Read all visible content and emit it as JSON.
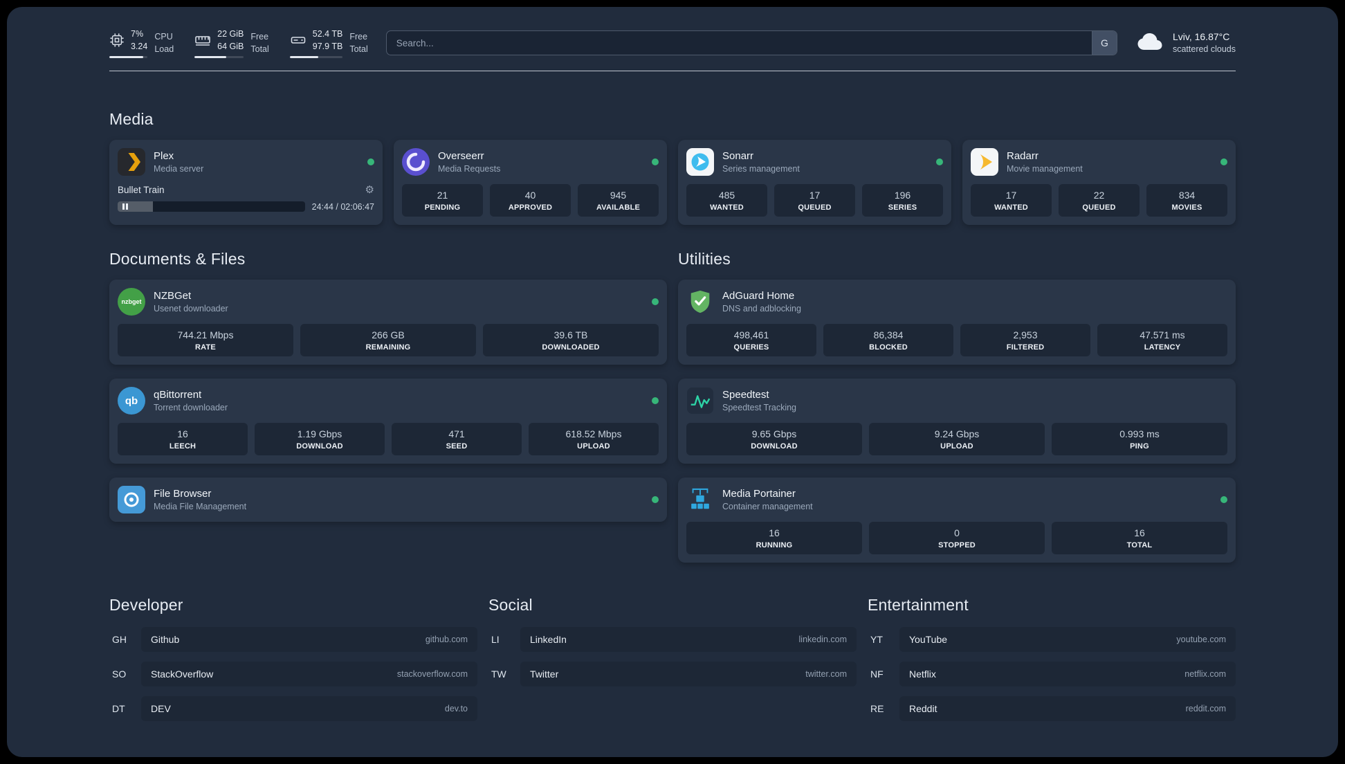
{
  "topbar": {
    "cpu": {
      "value_top": "7%",
      "value_bottom": "3.24",
      "label_top": "CPU",
      "label_bottom": "Load",
      "progress": 88
    },
    "memory": {
      "value_top": "22 GiB",
      "value_bottom": "64 GiB",
      "label_top": "Free",
      "label_bottom": "Total",
      "progress": 64
    },
    "disk": {
      "value_top": "52.4 TB",
      "value_bottom": "97.9 TB",
      "label_top": "Free",
      "label_bottom": "Total",
      "progress": 54
    },
    "search": {
      "placeholder": "Search...",
      "provider_button": "G"
    },
    "weather": {
      "location": "Lviv, 16.87°C",
      "description": "scattered clouds"
    }
  },
  "sections": {
    "media": "Media",
    "documents": "Documents & Files",
    "utilities": "Utilities",
    "developer": "Developer",
    "social": "Social",
    "entertainment": "Entertainment"
  },
  "icons": {
    "nzbget_text": "nzbget",
    "qbittorrent_text": "qb"
  },
  "apps": {
    "plex": {
      "name": "Plex",
      "description": "Media server",
      "now_playing": {
        "title": "Bullet Train",
        "time": "24:44 / 02:06:47",
        "progress": 19
      }
    },
    "overseerr": {
      "name": "Overseerr",
      "description": "Media Requests",
      "stats": [
        {
          "value": "21",
          "label": "PENDING"
        },
        {
          "value": "40",
          "label": "APPROVED"
        },
        {
          "value": "945",
          "label": "AVAILABLE"
        }
      ]
    },
    "sonarr": {
      "name": "Sonarr",
      "description": "Series management",
      "stats": [
        {
          "value": "485",
          "label": "WANTED"
        },
        {
          "value": "17",
          "label": "QUEUED"
        },
        {
          "value": "196",
          "label": "SERIES"
        }
      ]
    },
    "radarr": {
      "name": "Radarr",
      "description": "Movie management",
      "stats": [
        {
          "value": "17",
          "label": "WANTED"
        },
        {
          "value": "22",
          "label": "QUEUED"
        },
        {
          "value": "834",
          "label": "MOVIES"
        }
      ]
    },
    "nzbget": {
      "name": "NZBGet",
      "description": "Usenet downloader",
      "stats": [
        {
          "value": "744.21 Mbps",
          "label": "RATE"
        },
        {
          "value": "266 GB",
          "label": "REMAINING"
        },
        {
          "value": "39.6 TB",
          "label": "DOWNLOADED"
        }
      ]
    },
    "qbittorrent": {
      "name": "qBittorrent",
      "description": "Torrent downloader",
      "stats": [
        {
          "value": "16",
          "label": "LEECH"
        },
        {
          "value": "1.19 Gbps",
          "label": "DOWNLOAD"
        },
        {
          "value": "471",
          "label": "SEED"
        },
        {
          "value": "618.52 Mbps",
          "label": "UPLOAD"
        }
      ]
    },
    "filebrowser": {
      "name": "File Browser",
      "description": "Media File Management"
    },
    "adguard": {
      "name": "AdGuard Home",
      "description": "DNS and adblocking",
      "stats": [
        {
          "value": "498,461",
          "label": "QUERIES"
        },
        {
          "value": "86,384",
          "label": "BLOCKED"
        },
        {
          "value": "2,953",
          "label": "FILTERED"
        },
        {
          "value": "47.571 ms",
          "label": "LATENCY"
        }
      ]
    },
    "speedtest": {
      "name": "Speedtest",
      "description": "Speedtest Tracking",
      "stats": [
        {
          "value": "9.65 Gbps",
          "label": "DOWNLOAD"
        },
        {
          "value": "9.24 Gbps",
          "label": "UPLOAD"
        },
        {
          "value": "0.993 ms",
          "label": "PING"
        }
      ]
    },
    "portainer": {
      "name": "Media Portainer",
      "description": "Container management",
      "stats": [
        {
          "value": "16",
          "label": "RUNNING"
        },
        {
          "value": "0",
          "label": "STOPPED"
        },
        {
          "value": "16",
          "label": "TOTAL"
        }
      ]
    }
  },
  "bookmarks": {
    "developer": [
      {
        "abbr": "GH",
        "name": "Github",
        "url": "github.com"
      },
      {
        "abbr": "SO",
        "name": "StackOverflow",
        "url": "stackoverflow.com"
      },
      {
        "abbr": "DT",
        "name": "DEV",
        "url": "dev.to"
      }
    ],
    "social": [
      {
        "abbr": "LI",
        "name": "LinkedIn",
        "url": "linkedin.com"
      },
      {
        "abbr": "TW",
        "name": "Twitter",
        "url": "twitter.com"
      }
    ],
    "entertainment": [
      {
        "abbr": "YT",
        "name": "YouTube",
        "url": "youtube.com"
      },
      {
        "abbr": "NF",
        "name": "Netflix",
        "url": "netflix.com"
      },
      {
        "abbr": "RE",
        "name": "Reddit",
        "url": "reddit.com"
      }
    ]
  },
  "colors": {
    "background": "#212c3d",
    "card": "#2a3648",
    "tile": "#1d2736",
    "status_online": "#37b679",
    "plex_accent": "#e5a00d",
    "overseerr_purple": "#5a4fcf",
    "sonarr_blue": "#3fbcee",
    "radarr_yellow": "#f6b92f",
    "nzbget_green": "#43a047",
    "qbittorrent_blue": "#3b97d3",
    "filebrowser_blue": "#459ad7",
    "adguard_green": "#63b463",
    "speedtest_green": "#2dd4a7",
    "portainer_blue": "#2fa8e0"
  }
}
